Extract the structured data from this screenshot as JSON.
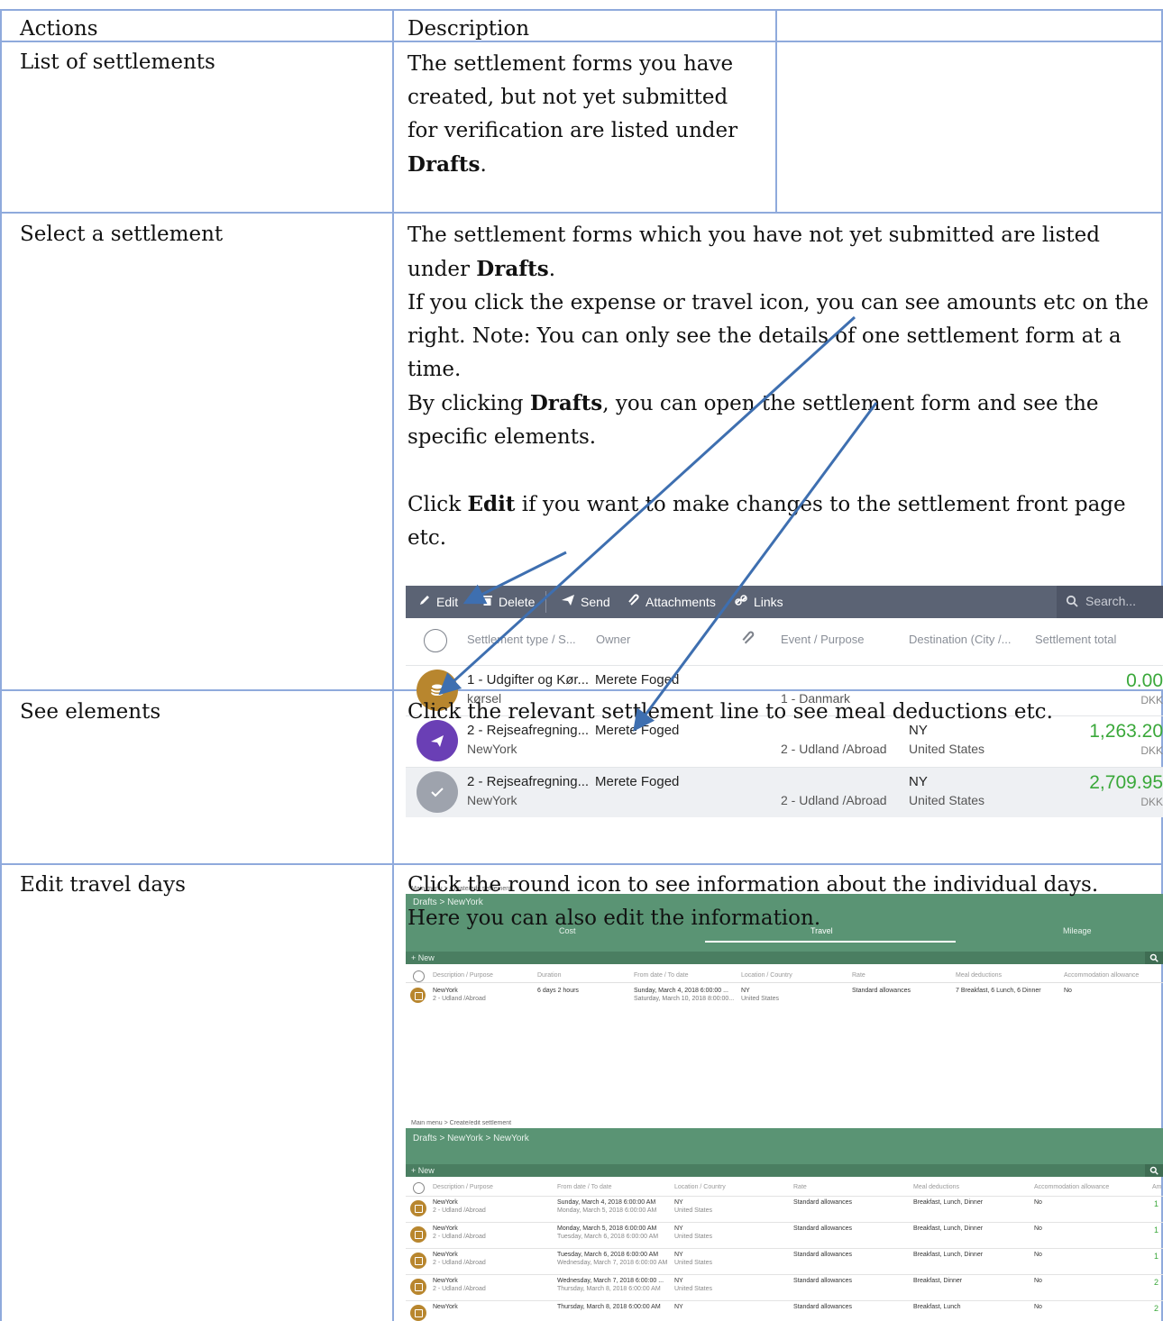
{
  "table": {
    "headers": [
      "Actions",
      "Description",
      ""
    ],
    "rows": [
      {
        "action": "List of settlements",
        "description_html": "The settlement forms you have created, but not yet submitted for verification are listed under <b>Drafts</b>."
      },
      {
        "action": "Select a settlement",
        "description_paragraphs": [
          "The settlement forms which you have not yet submitted are listed under <b>Drafts</b>.",
          "If you click the expense or travel icon, you can see amounts etc on the right. Note: You can only see the details of one settlement form at a time.",
          "By clicking <b>Drafts</b>, you can open the settlement form and see the specific elements.",
          "Click <b>Edit</b> if you want to make changes to the settlement front page etc."
        ]
      },
      {
        "action": "See elements",
        "description": "Click the relevant settlement line to see meal deductions etc."
      },
      {
        "action": "Edit travel days",
        "description_paragraphs": [
          "Click the round icon to see information about the individual days.",
          "Here you can also edit the information."
        ]
      }
    ]
  },
  "screenshot1": {
    "toolbar": {
      "edit": "Edit",
      "delete": "Delete",
      "send": "Send",
      "attachments": "Attachments",
      "links": "Links",
      "search_placeholder": "Search..."
    },
    "columns": [
      "Settlement type / S...",
      "Owner",
      "Event / Purpose",
      "Destination (City /...",
      "Settlement total"
    ],
    "rows": [
      {
        "type": "1 - Udgifter og Kør...",
        "sub": "kørsel",
        "owner": "Merete Foged",
        "event": "1 - Danmark",
        "city": "",
        "country": "",
        "amount": "0.00",
        "currency": "DKK",
        "icon_color": "#b8862e",
        "icon": "coins-icon"
      },
      {
        "type": "2 - Rejseafregning...",
        "sub": "NewYork",
        "owner": "Merete Foged",
        "event": "2 - Udland /Abroad",
        "city": "NY",
        "country": "United States",
        "amount": "1,263.20",
        "currency": "DKK",
        "icon_color": "#6a3fb5",
        "icon": "airplane-icon"
      },
      {
        "type": "2 - Rejseafregning...",
        "sub": "NewYork",
        "owner": "Merete Foged",
        "event": "2 - Udland /Abroad",
        "city": "NY",
        "country": "United States",
        "amount": "2,709.95",
        "currency": "DKK",
        "icon_color": "#9ea3ad",
        "icon": "check-icon"
      }
    ]
  },
  "screenshot2": {
    "breadcrumb_small": "Main menu > Create/edit settlement",
    "title": "Drafts > NewYork",
    "tabs": [
      "Cost",
      "Travel",
      "Mileage"
    ],
    "new_label": "New",
    "columns": [
      "Description / Purpose",
      "Duration",
      "From date / To date",
      "Location / Country",
      "Rate",
      "Meal deductions",
      "Accommodation allowance"
    ],
    "row": {
      "description": "NewYork",
      "sub": "2 - Udland /Abroad",
      "duration": "6 days 2 hours",
      "from": "Sunday, March 4, 2018 6:00:00 ...",
      "to": "Saturday, March 10, 2018 8:00:00...",
      "location": "NY",
      "country": "United States",
      "rate": "Standard allowances",
      "meals": "7 Breakfast, 6 Lunch, 6 Dinner",
      "accommodation": "No"
    }
  },
  "screenshot3": {
    "breadcrumb_small": "Main menu > Create/edit settlement",
    "title": "Drafts > NewYork > NewYork",
    "new_label": "New",
    "columns": [
      "Description / Purpose",
      "From date / To date",
      "Location / Country",
      "Rate",
      "Meal deductions",
      "Accommodation allowance",
      "Am"
    ],
    "rows": [
      {
        "desc": "NewYork",
        "sub": "2 - Udland /Abroad",
        "from": "Sunday, March 4, 2018 6:00:00 AM",
        "to": "Monday, March 5, 2018 6:00:00 AM",
        "loc": "NY",
        "country": "United States",
        "rate": "Standard allowances",
        "meals": "Breakfast, Lunch, Dinner",
        "acc": "No",
        "amt": "1"
      },
      {
        "desc": "NewYork",
        "sub": "2 - Udland /Abroad",
        "from": "Monday, March 5, 2018 6:00:00 AM",
        "to": "Tuesday, March 6, 2018 6:00:00 AM",
        "loc": "NY",
        "country": "United States",
        "rate": "Standard allowances",
        "meals": "Breakfast, Lunch, Dinner",
        "acc": "No",
        "amt": "1"
      },
      {
        "desc": "NewYork",
        "sub": "2 - Udland /Abroad",
        "from": "Tuesday, March 6, 2018 6:00:00 AM",
        "to": "Wednesday, March 7, 2018 6:00:00 AM",
        "loc": "NY",
        "country": "United States",
        "rate": "Standard allowances",
        "meals": "Breakfast, Lunch, Dinner",
        "acc": "No",
        "amt": "1"
      },
      {
        "desc": "NewYork",
        "sub": "2 - Udland /Abroad",
        "from": "Wednesday, March 7, 2018 6:00:00 ...",
        "to": "Thursday, March 8, 2018 6:00:00 AM",
        "loc": "NY",
        "country": "United States",
        "rate": "Standard allowances",
        "meals": "Breakfast, Dinner",
        "acc": "No",
        "amt": "2"
      },
      {
        "desc": "NewYork",
        "sub": "",
        "from": "Thursday, March 8, 2018 6:00:00 AM",
        "to": "",
        "loc": "NY",
        "country": "",
        "rate": "Standard allowances",
        "meals": "Breakfast, Lunch",
        "acc": "No",
        "amt": "2"
      }
    ]
  }
}
